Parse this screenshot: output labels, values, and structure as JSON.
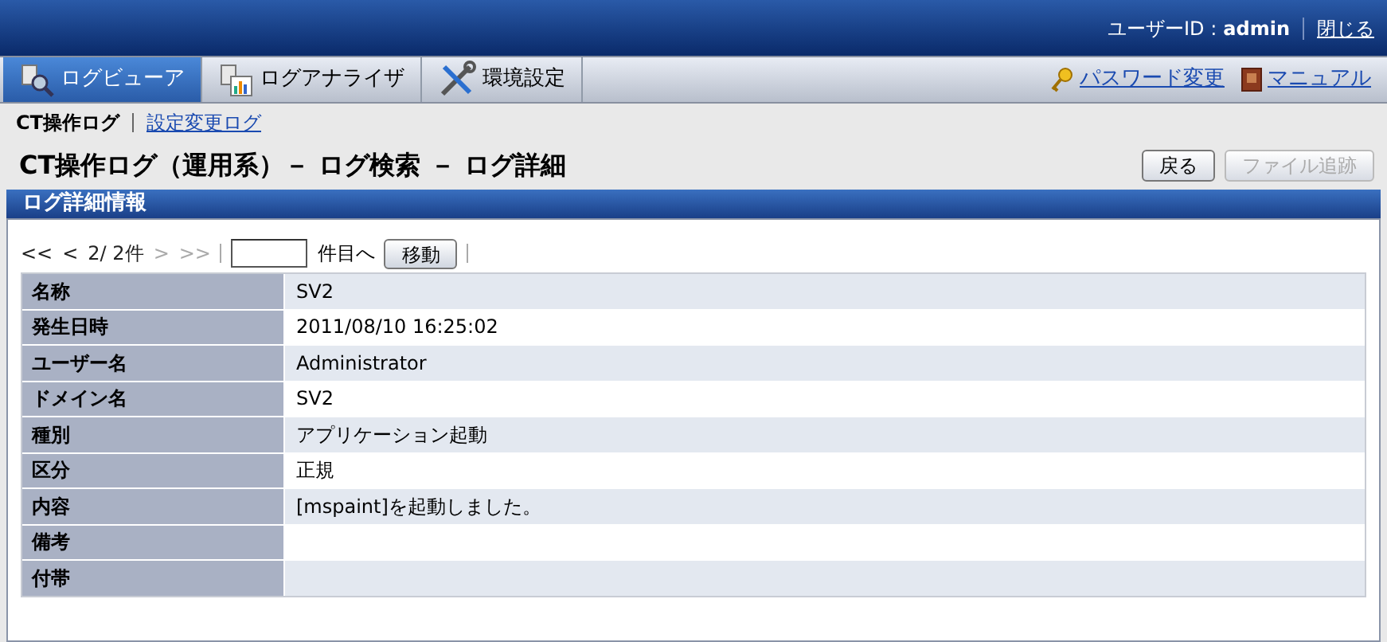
{
  "header": {
    "user_label": "ユーザーID :",
    "user_id": "admin",
    "logout": "閉じる"
  },
  "tabs": [
    {
      "label": "ログビューア",
      "kind": "viewer",
      "selected": true
    },
    {
      "label": "ログアナライザ",
      "kind": "analyzer",
      "selected": false
    },
    {
      "label": "環境設定",
      "kind": "settings",
      "selected": false
    }
  ],
  "top_links": [
    {
      "label": "パスワード変更",
      "kind": "key"
    },
    {
      "label": "マニュアル",
      "kind": "book"
    }
  ],
  "subnav": [
    {
      "label": "CT操作ログ",
      "selected": true
    },
    {
      "label": "設定変更ログ",
      "selected": false
    }
  ],
  "page_title": "CT操作ログ（運用系）－ ログ検索 － ログ詳細",
  "actions": [
    {
      "label": "戻る",
      "disabled": false
    },
    {
      "label": "ファイル追跡",
      "disabled": true
    }
  ],
  "panel": {
    "title": "ログ詳細情報",
    "pager": {
      "items": [
        {
          "label": "<<",
          "disabled": false
        },
        {
          "label": "<",
          "disabled": false
        },
        {
          "label": "2/ 2件",
          "disabled": false
        },
        {
          "label": ">",
          "disabled": true
        },
        {
          "label": ">>",
          "disabled": true
        }
      ],
      "suffix": "件目へ",
      "button": "移動"
    },
    "rows": [
      {
        "label": "名称",
        "value": "SV2"
      },
      {
        "label": "発生日時",
        "value": "2011/08/10 16:25:02"
      },
      {
        "label": "ユーザー名",
        "value": "Administrator"
      },
      {
        "label": "ドメイン名",
        "value": "SV2"
      },
      {
        "label": "種別",
        "value": "アプリケーション起動"
      },
      {
        "label": "区分",
        "value": "正規"
      },
      {
        "label": "内容",
        "value": "[mspaint]を起動しました。"
      },
      {
        "label": "備考"
      },
      {
        "label": "付帯"
      }
    ]
  }
}
